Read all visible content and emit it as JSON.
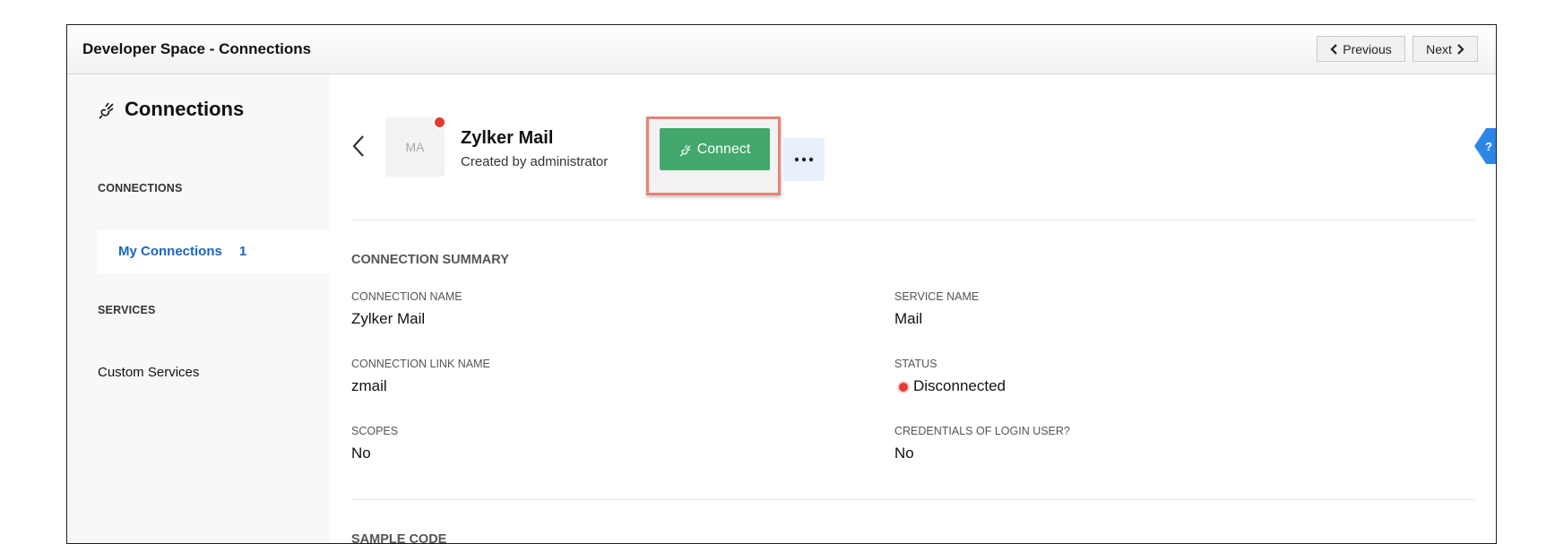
{
  "window": {
    "title": "Developer Space - Connections",
    "previous_label": "Previous",
    "next_label": "Next"
  },
  "sidebar": {
    "header": "Connections",
    "sections": [
      {
        "title": "CONNECTIONS"
      },
      {
        "title": "SERVICES"
      }
    ],
    "items": [
      {
        "label": "My Connections",
        "count": "1",
        "active": true
      },
      {
        "label": "Custom Services",
        "active": false
      }
    ]
  },
  "connection": {
    "avatar_text": "MA",
    "name": "Zylker Mail",
    "creator": "Created by administrator",
    "connect_label": "Connect"
  },
  "summary": {
    "title": "CONNECTION SUMMARY",
    "fields": [
      {
        "label": "CONNECTION NAME",
        "value": "Zylker Mail"
      },
      {
        "label": "SERVICE NAME",
        "value": "Mail"
      },
      {
        "label": "CONNECTION LINK NAME",
        "value": "zmail"
      },
      {
        "label": "STATUS",
        "value": "Disconnected"
      },
      {
        "label": "SCOPES",
        "value": "No"
      },
      {
        "label": "CREDENTIALS OF LOGIN USER?",
        "value": "No"
      }
    ]
  },
  "sample_code": {
    "title": "SAMPLE CODE"
  },
  "help": {
    "label": "?"
  },
  "colors": {
    "accent": "#1a63c7",
    "connect_button": "#42a86b",
    "status_disconnected": "#e53935",
    "highlight_border": "#e78376"
  },
  "icons": {
    "connections": "plug-icon",
    "back": "chevron-left-icon",
    "more": "more-horizontal-icon",
    "status": "red-dot-icon"
  }
}
